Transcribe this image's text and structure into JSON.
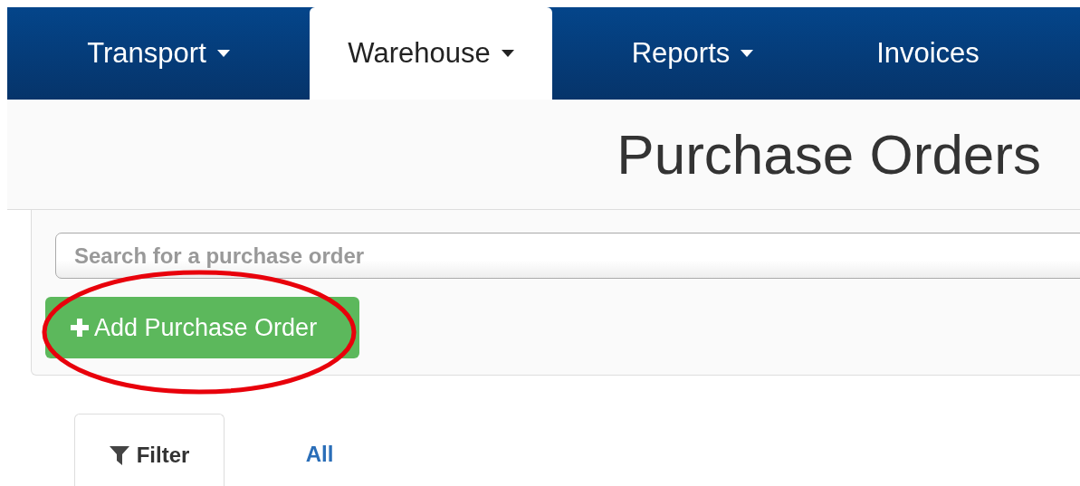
{
  "nav": {
    "items": [
      {
        "label": "Transport",
        "dropdown": true,
        "selected": false
      },
      {
        "label": "Warehouse",
        "dropdown": true,
        "selected": true
      },
      {
        "label": "Reports",
        "dropdown": true,
        "selected": false
      },
      {
        "label": "Invoices",
        "dropdown": false,
        "selected": false
      }
    ]
  },
  "page_title": "Purchase Orders",
  "search": {
    "placeholder": "Search for a purchase order"
  },
  "add_button": {
    "label": "Add Purchase Order",
    "highlighted": true
  },
  "tabs": [
    {
      "label": "Filter",
      "kind": "filter",
      "selected": true
    },
    {
      "label": "All",
      "kind": "link",
      "selected": false
    }
  ]
}
